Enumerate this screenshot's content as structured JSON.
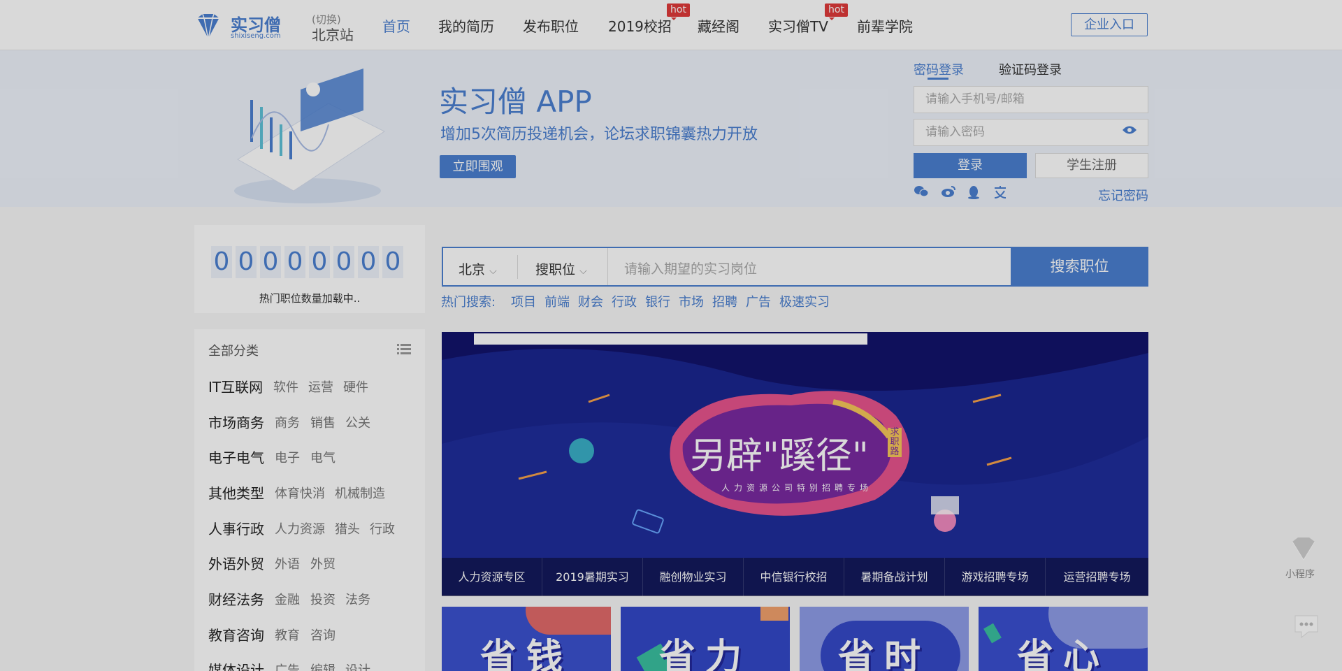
{
  "header": {
    "logo_name": "实习僧",
    "logo_domain": "shixiseng.com",
    "city_switch": "(切换)",
    "city_name": "北京站",
    "nav": [
      {
        "label": "首页"
      },
      {
        "label": "我的简历"
      },
      {
        "label": "发布职位"
      },
      {
        "label": "2019校招",
        "badge": "hot"
      },
      {
        "label": "藏经阁"
      },
      {
        "label": "实习僧TV",
        "badge": "hot"
      },
      {
        "label": "前辈学院"
      }
    ],
    "enterprise": "企业入口"
  },
  "banner": {
    "title": "实习僧 APP",
    "subtitle": "增加5次简历投递机会，论坛求职锦囊热力开放",
    "button": "立即围观"
  },
  "login": {
    "tab_password": "密码登录",
    "tab_code": "验证码登录",
    "phone_placeholder": "请输入手机号/邮箱",
    "password_placeholder": "请输入密码",
    "login_button": "登录",
    "register_button": "学生注册",
    "forgot": "忘记密码"
  },
  "counter": {
    "digits": [
      "0",
      "0",
      "0",
      "0",
      "0",
      "0",
      "0",
      "0"
    ],
    "label": "热门职位数量加载中.."
  },
  "categories": {
    "header": "全部分类",
    "items": [
      {
        "name": "IT互联网",
        "subs": [
          "软件",
          "运营",
          "硬件"
        ]
      },
      {
        "name": "市场商务",
        "subs": [
          "商务",
          "销售",
          "公关"
        ]
      },
      {
        "name": "电子电气",
        "subs": [
          "电子",
          "电气"
        ]
      },
      {
        "name": "其他类型",
        "subs": [
          "体育快消",
          "机械制造"
        ]
      },
      {
        "name": "人事行政",
        "subs": [
          "人力资源",
          "猎头",
          "行政"
        ]
      },
      {
        "name": "外语外贸",
        "subs": [
          "外语",
          "外贸"
        ]
      },
      {
        "name": "财经法务",
        "subs": [
          "金融",
          "投资",
          "法务"
        ]
      },
      {
        "name": "教育咨询",
        "subs": [
          "教育",
          "咨询"
        ]
      },
      {
        "name": "媒体设计",
        "subs": [
          "广告",
          "编辑",
          "设计"
        ]
      }
    ]
  },
  "search": {
    "city": "北京",
    "type": "搜职位",
    "placeholder": "请输入期望的实习岗位",
    "button": "搜索职位",
    "hot_label": "热门搜索:",
    "hot_terms": [
      "项目",
      "前端",
      "财会",
      "行政",
      "银行",
      "市场",
      "招聘",
      "广告",
      "极速实习"
    ]
  },
  "carousel": {
    "title": "另辟\"蹊径\"",
    "tag": "求职路",
    "subtitle": "人力资源公司特别招聘专场",
    "tabs": [
      "人力资源专区",
      "2019暑期实习",
      "融创物业实习",
      "中信银行校招",
      "暑期备战计划",
      "游戏招聘专场",
      "运营招聘专场"
    ]
  },
  "promos": [
    "省钱",
    "省力",
    "省时",
    "省心"
  ],
  "side": {
    "mini_program": "小程序"
  },
  "colors": {
    "accent": "#4a7fd0",
    "hot": "#e03a3a",
    "carousel_bg": "#12136b"
  }
}
